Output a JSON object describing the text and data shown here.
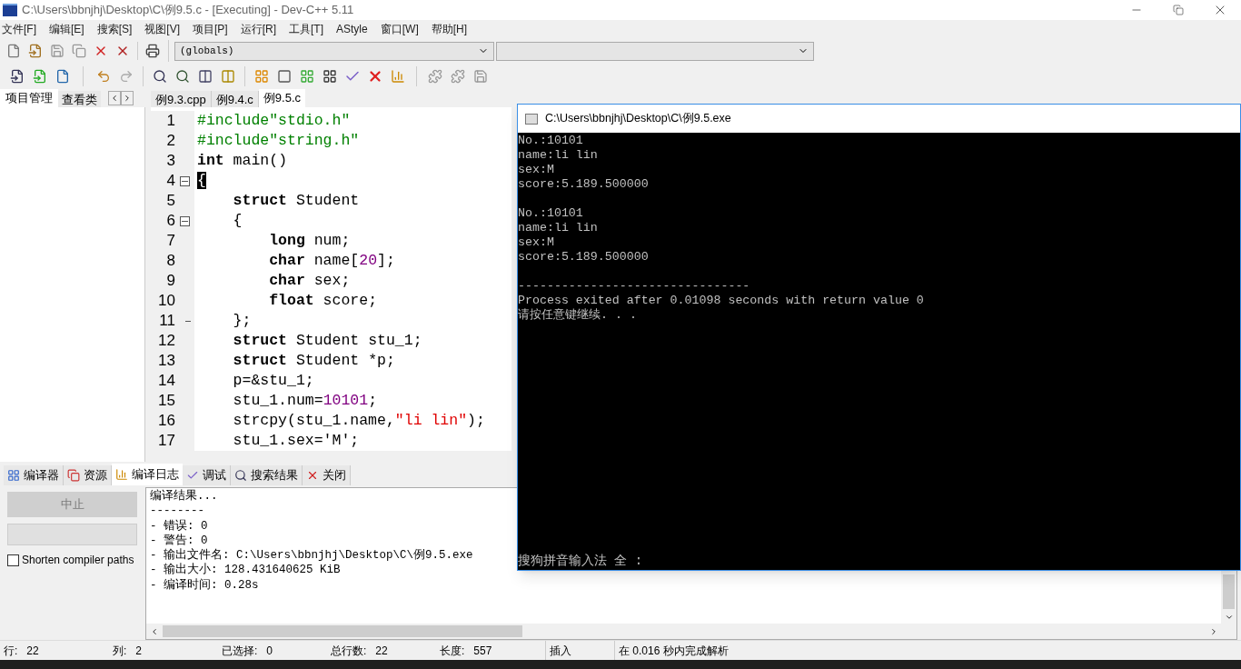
{
  "window": {
    "title": "C:\\Users\\bbnjhj\\Desktop\\C\\例9.5.c - [Executing] - Dev-C++ 5.11"
  },
  "menu": [
    "文件[F]",
    "编辑[E]",
    "搜索[S]",
    "视图[V]",
    "项目[P]",
    "运行[R]",
    "工具[T]",
    "AStyle",
    "窗口[W]",
    "帮助[H]"
  ],
  "scope_dropdown": {
    "value": "(globals)"
  },
  "left_tabs": [
    {
      "label": "项目管理",
      "selected": true
    },
    {
      "label": "查看类",
      "selected": false
    }
  ],
  "editor_tabs": [
    {
      "label": "例9.3.cpp",
      "selected": false
    },
    {
      "label": "例9.4.c",
      "selected": false
    },
    {
      "label": "例9.5.c",
      "selected": true
    }
  ],
  "code_lines": [
    {
      "number": "1",
      "tokens": [
        {
          "kind": "pre",
          "text": "#include\"stdio.h\""
        }
      ]
    },
    {
      "number": "2",
      "tokens": [
        {
          "kind": "pre",
          "text": "#include\"string.h\""
        }
      ]
    },
    {
      "number": "3",
      "tokens": [
        {
          "kind": "kw",
          "text": "int"
        },
        {
          "kind": "plain",
          "text": " main()"
        }
      ]
    },
    {
      "number": "4",
      "fold_start": true,
      "tokens": [
        {
          "kind": "match",
          "text": "{"
        }
      ]
    },
    {
      "number": "5",
      "kind": "block",
      "tokens": [
        {
          "kind": "kw",
          "text": "struct"
        },
        {
          "kind": "plain",
          "text": " Student"
        }
      ]
    },
    {
      "number": "6",
      "fold_start": true,
      "kind": "block",
      "tokens": [
        {
          "kind": "plain",
          "text": "{"
        }
      ]
    },
    {
      "number": "7",
      "kind": "inner",
      "tokens": [
        {
          "kind": "kw",
          "text": "long"
        },
        {
          "kind": "plain",
          "text": " num;"
        }
      ]
    },
    {
      "number": "8",
      "kind": "inner",
      "tokens": [
        {
          "kind": "kw",
          "text": "char"
        },
        {
          "kind": "plain",
          "text": " name["
        },
        {
          "kind": "num",
          "text": "20"
        },
        {
          "kind": "plain",
          "text": "];"
        }
      ]
    },
    {
      "number": "9",
      "kind": "inner",
      "tokens": [
        {
          "kind": "kw",
          "text": "char"
        },
        {
          "kind": "plain",
          "text": " sex;"
        }
      ]
    },
    {
      "number": "10",
      "kind": "inner",
      "tokens": [
        {
          "kind": "kw",
          "text": "float"
        },
        {
          "kind": "plain",
          "text": " score;"
        }
      ]
    },
    {
      "number": "11",
      "fold_end": true,
      "kind": "block",
      "tokens": [
        {
          "kind": "plain",
          "text": "};"
        }
      ]
    },
    {
      "number": "12",
      "kind": "block",
      "tokens": [
        {
          "kind": "kw",
          "text": "struct"
        },
        {
          "kind": "plain",
          "text": " Student stu_1;"
        }
      ]
    },
    {
      "number": "13",
      "kind": "block",
      "tokens": [
        {
          "kind": "kw",
          "text": "struct"
        },
        {
          "kind": "plain",
          "text": " Student *p;"
        }
      ]
    },
    {
      "number": "14",
      "kind": "block",
      "tokens": [
        {
          "kind": "plain",
          "text": "p=&stu_1;"
        }
      ]
    },
    {
      "number": "15",
      "kind": "block",
      "tokens": [
        {
          "kind": "plain",
          "text": "stu_1.num="
        },
        {
          "kind": "num",
          "text": "10101"
        },
        {
          "kind": "plain",
          "text": ";"
        }
      ]
    },
    {
      "number": "16",
      "kind": "block",
      "tokens": [
        {
          "kind": "plain",
          "text": "strcpy(stu_1.name,"
        },
        {
          "kind": "str",
          "text": "\"li lin\""
        },
        {
          "kind": "plain",
          "text": ");"
        }
      ]
    },
    {
      "number": "17",
      "kind": "block",
      "tokens": [
        {
          "kind": "plain",
          "text": "stu_1.sex='M';"
        }
      ]
    }
  ],
  "bottom_tabs": [
    {
      "label": "编译器",
      "selected": false
    },
    {
      "label": "资源",
      "selected": false
    },
    {
      "label": "编译日志",
      "selected": true
    },
    {
      "label": "调试",
      "selected": false
    },
    {
      "label": "搜索结果",
      "selected": false
    },
    {
      "label": "关闭",
      "selected": false
    }
  ],
  "abort_button": {
    "label": "中止",
    "disabled": true
  },
  "shorten_paths": {
    "label": "Shorten compiler paths",
    "checked": false
  },
  "compile_log": [
    "编译结果...",
    "--------",
    "- 错误: 0",
    "- 警告: 0",
    "- 输出文件名: C:\\Users\\bbnjhj\\Desktop\\C\\例9.5.exe",
    "- 输出大小: 128.431640625 KiB",
    "- 编译时间: 0.28s"
  ],
  "status_bar": [
    {
      "label": "行:",
      "value": "22"
    },
    {
      "label": "列:",
      "value": "2"
    },
    {
      "label": "已选择:",
      "value": "0"
    },
    {
      "label": "总行数:",
      "value": "22"
    },
    {
      "label": "长度:",
      "value": "557"
    },
    {
      "label": "插入"
    },
    {
      "label": "在 0.016 秒内完成解析"
    }
  ],
  "console": {
    "title": "C:\\Users\\bbnjhj\\Desktop\\C\\例9.5.exe",
    "lines": [
      {
        "text": "No.:10101"
      },
      {
        "text": "name:li lin"
      },
      {
        "text": "sex:M"
      },
      {
        "text": "score:5.189.500000"
      },
      {
        "text": "No.:10101",
        "gap_before": true
      },
      {
        "text": "name:li lin"
      },
      {
        "text": "sex:M"
      },
      {
        "text": "score:5.189.500000"
      },
      {
        "text": "--------------------------------",
        "gap_before": true
      },
      {
        "text": "Process exited after 0.01098 seconds with return value 0"
      },
      {
        "text": "请按任意键继续. . ."
      }
    ],
    "ime": "搜狗拼音输入法 全 :"
  }
}
